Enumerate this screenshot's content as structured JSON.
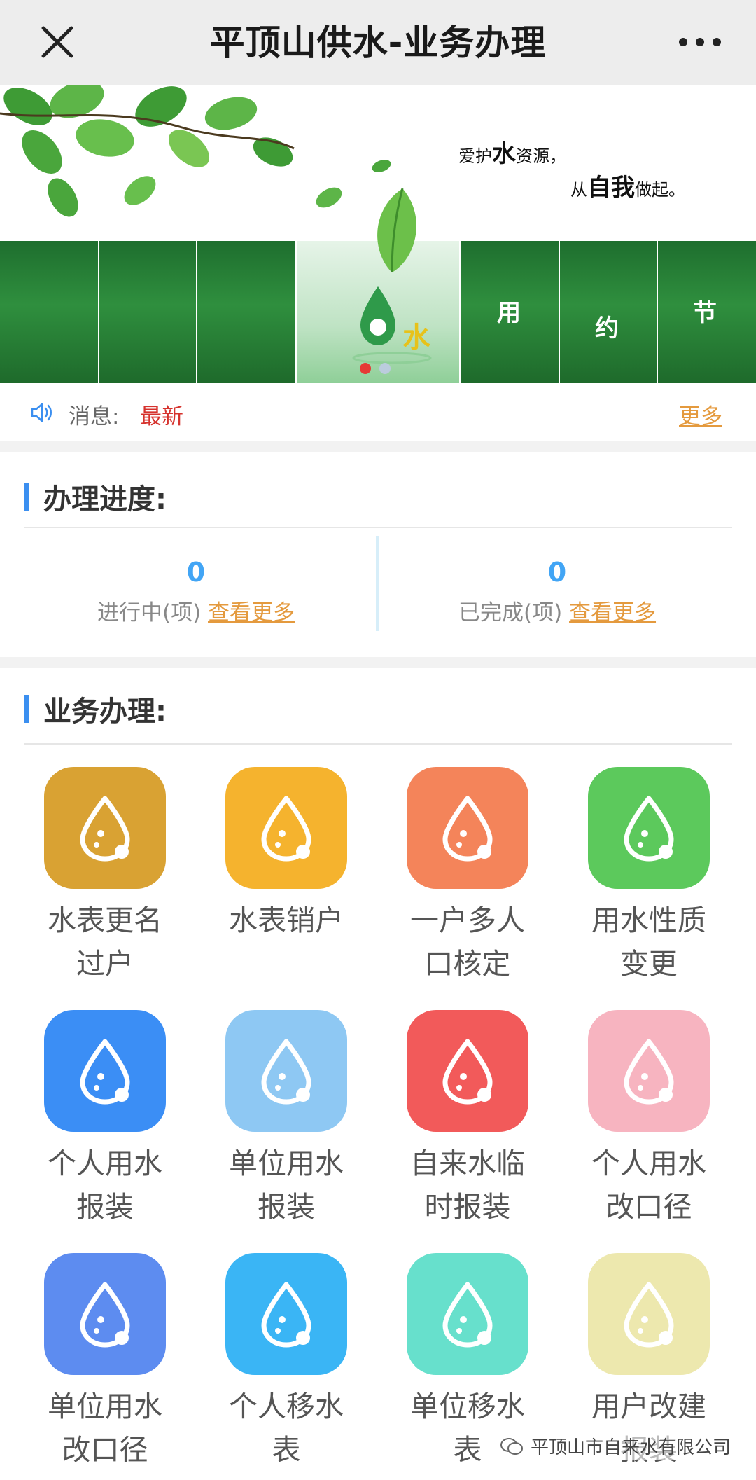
{
  "topbar": {
    "title": "平顶山供水-业务办理"
  },
  "banner": {
    "slogan_line1_pre": "爱护",
    "slogan_line1_big": "水",
    "slogan_line1_post": "资源，",
    "slogan_line2_pre": "从",
    "slogan_line2_big": "自我",
    "slogan_line2_post": "做起。",
    "logo_char": "水",
    "chars": [
      "用",
      "约",
      "节"
    ]
  },
  "message": {
    "label": "消息:",
    "value": "最新",
    "more": "更多"
  },
  "progress": {
    "title": "办理进度:",
    "in_progress": {
      "count": "0",
      "label": "进行中(项)",
      "link": "查看更多"
    },
    "completed": {
      "count": "0",
      "label": "已完成(项)",
      "link": "查看更多"
    }
  },
  "services": {
    "title": "业务办理:",
    "items": [
      {
        "label": "水表更名过户",
        "color": "#d9a233"
      },
      {
        "label": "水表销户",
        "color": "#f5b32e"
      },
      {
        "label": "一户多人口核定",
        "color": "#f4845a"
      },
      {
        "label": "用水性质变更",
        "color": "#5cc95c"
      },
      {
        "label": "个人用水报装",
        "color": "#3b8ef5"
      },
      {
        "label": "单位用水报装",
        "color": "#8ec8f3"
      },
      {
        "label": "自来水临时报装",
        "color": "#f25a5a"
      },
      {
        "label": "个人用水改口径",
        "color": "#f7b4c0"
      },
      {
        "label": "单位用水改口径",
        "color": "#5d8cf0"
      },
      {
        "label": "个人移水表",
        "color": "#3ab5f5"
      },
      {
        "label": "单位移水表",
        "color": "#67e0cc"
      },
      {
        "label": "用户改建报装",
        "color": "#ede8ae"
      }
    ]
  },
  "watermark": {
    "text": "平顶山市自来水有限公司"
  }
}
